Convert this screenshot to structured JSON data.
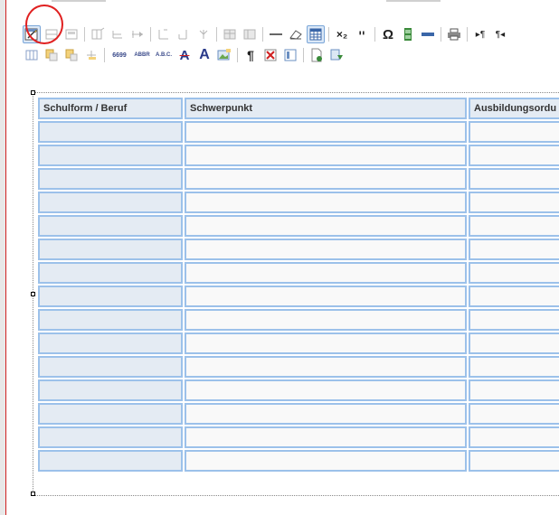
{
  "toolbar": {
    "row1": [
      "edit-table-properties",
      "row-above",
      "row-below",
      "split-cells-h",
      "split-cells-v",
      "merge-cells",
      "cell-props-1",
      "cell-props-2",
      "delete-cell",
      "table-a",
      "table-b",
      "horizontal-rule",
      "eraser",
      "table-grid",
      "subscript",
      "superscript",
      "omega-special-char",
      "media",
      "line-rule",
      "print",
      "ltr",
      "rtl"
    ],
    "row2": [
      "column-insert",
      "copy-col",
      "paste-col",
      "add-row",
      "cite",
      "abbr",
      "acronym",
      "strikethrough",
      "text-color",
      "insert-image",
      "pilcrow",
      "template-clear",
      "template-box",
      "new-document",
      "export"
    ],
    "subscript_label": "×₂",
    "superscript_label": "ײ",
    "abbr_label": "ABBR",
    "acronym_label": "A.B.C.",
    "cite_label": "6699"
  },
  "table": {
    "headers": [
      "Schulform / Beruf",
      "Schwerpunkt",
      "Ausbildungsordu"
    ],
    "row_count": 15
  }
}
